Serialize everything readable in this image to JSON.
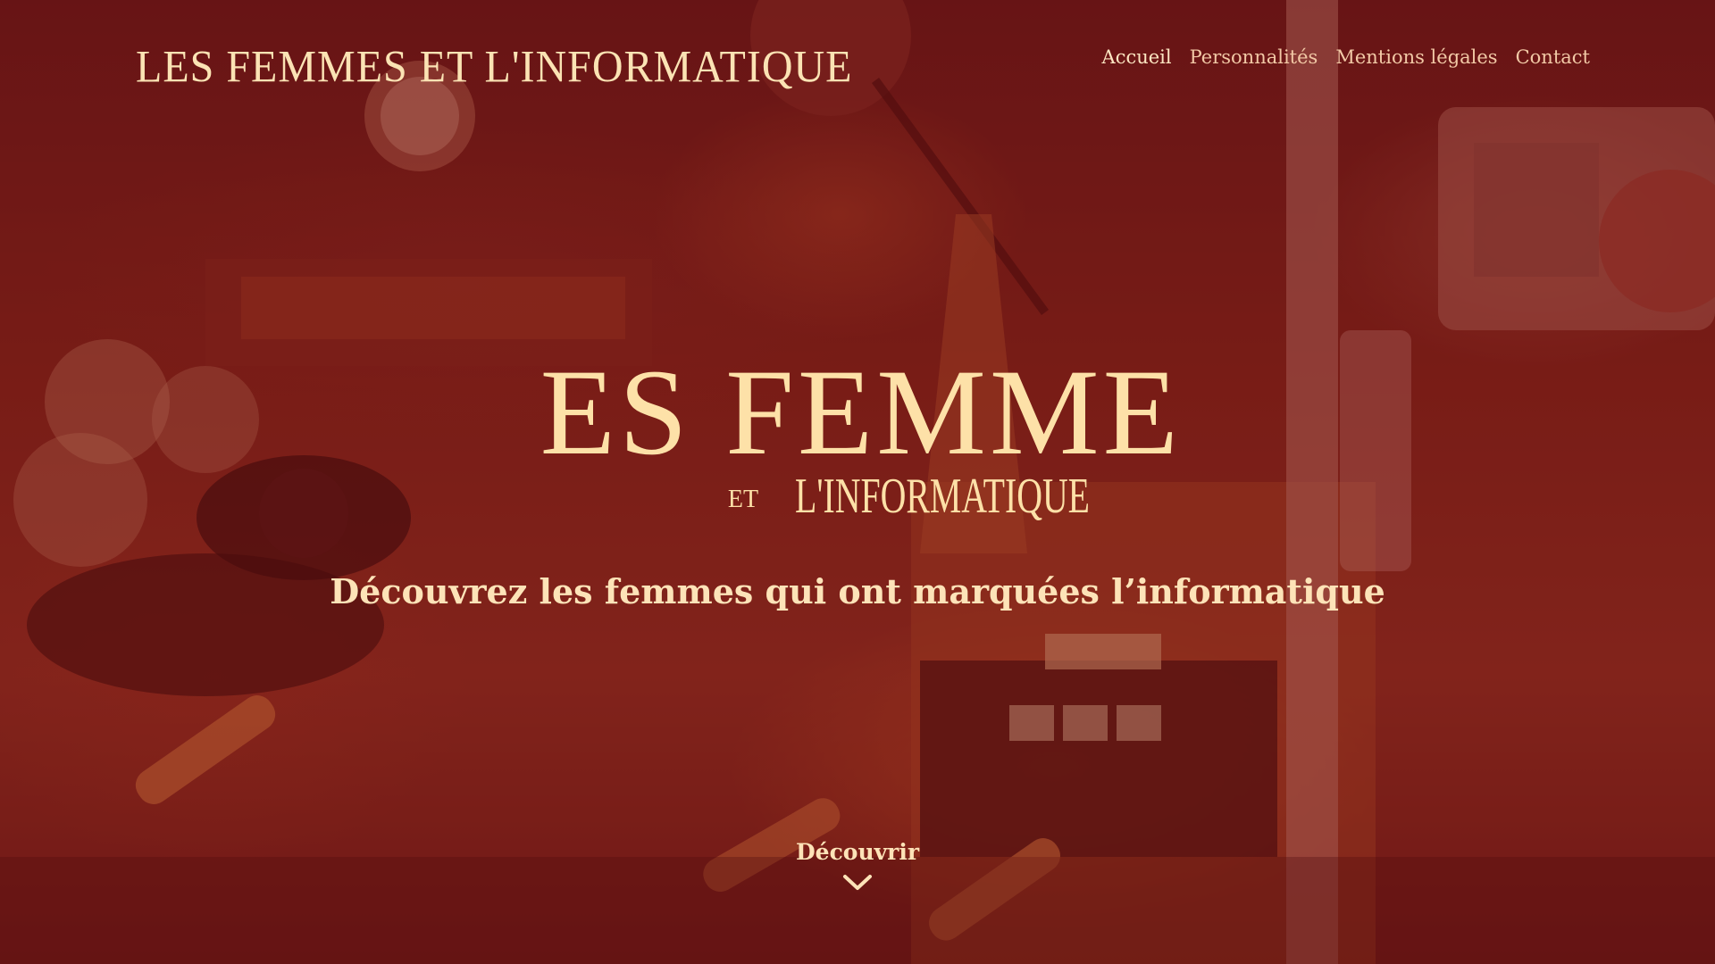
{
  "header": {
    "logo_text": "LES FEMMES ET L'INFORMATIQUE",
    "nav": [
      {
        "label": "Accueil",
        "active": true
      },
      {
        "label": "Personnalités",
        "active": false
      },
      {
        "label": "Mentions légales",
        "active": false
      },
      {
        "label": "Contact",
        "active": false
      }
    ]
  },
  "hero": {
    "logo_line1": "LES FEMMES",
    "logo_et": "ET",
    "logo_line2": "L'INFORMATIQUE",
    "tagline": "Découvrez les femmes qui ont marquées l’informatique",
    "discover_label": "Découvrir",
    "discover_icon": "chevron-down-icon"
  },
  "colors": {
    "overlay": "#7a1216",
    "text_cream": "#fde3b8",
    "nav_text": "#f2c9a6"
  }
}
